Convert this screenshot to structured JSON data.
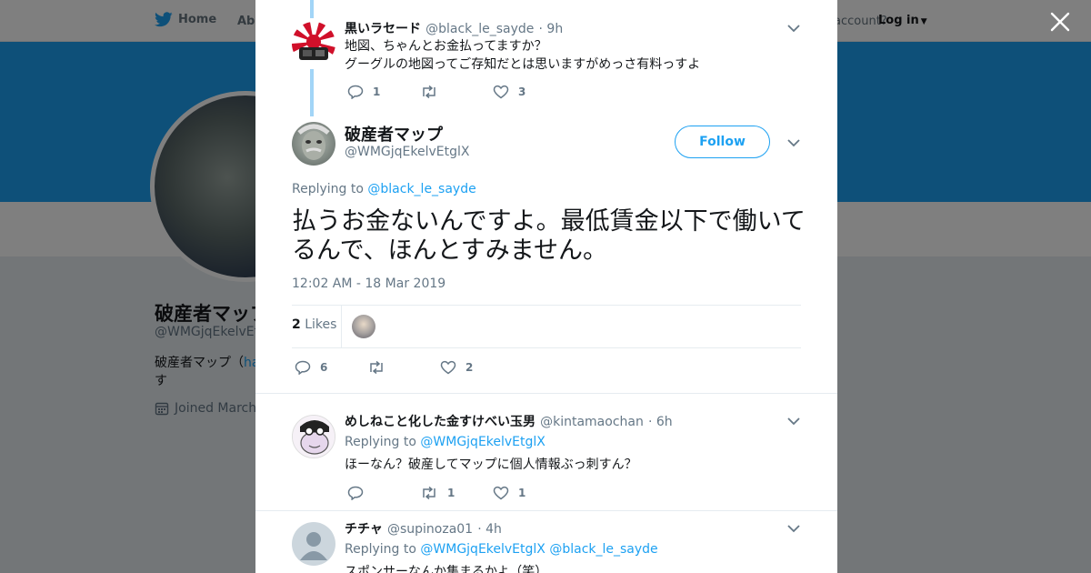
{
  "topbar": {
    "home_label": "Home",
    "about_label": "Abo",
    "account_prompt": "account?",
    "login_label": "Log in"
  },
  "profile": {
    "name": "破産者マップ",
    "handle": "@WMGjqEkelvEtg",
    "bio_prefix": "破産者マップ（",
    "bio_link": "ha",
    "bio_line2": "す",
    "joined": "Joined March"
  },
  "parent_tweet": {
    "name": "黒いラセード",
    "handle": "@black_le_sayde",
    "time": "· 9h",
    "line1": "地図、ちゃんとお金払ってますか？",
    "line2": "グーグルの地図ってご存知だとは思いますがめっさ有料っすよ",
    "replies": "1",
    "retweets": "",
    "likes": "3"
  },
  "main_tweet": {
    "name": "破産者マップ",
    "handle": "@WMGjqEkelvEtglX",
    "follow_label": "Follow",
    "replying_prefix": "Replying to ",
    "replying_to": "@black_le_sayde",
    "text": "払うお金ないんですよ。最低賃金以下で働いてるんで、ほんとすみません。",
    "timestamp": "12:02 AM - 18 Mar 2019",
    "likes_count": "2",
    "likes_label": "Likes",
    "replies": "6",
    "retweets": "",
    "likes": "2"
  },
  "reply1": {
    "name": "めしねこと化した金すけべい玉男",
    "handle": "@kintamaochan",
    "time": "· 6h",
    "replying_prefix": "Replying to ",
    "replying_to": "@WMGjqEkelvEtglX",
    "text": "ほーなん？破産してマップに個人情報ぶっ刺すん？",
    "replies": "",
    "retweets": "1",
    "likes": "1"
  },
  "reply2": {
    "name": "チチャ",
    "handle": "@supinoza01",
    "time": "· 4h",
    "replying_prefix": "Replying to ",
    "replying_to_1": "@WMGjqEkelvEtglX",
    "replying_to_2": "@black_le_sayde",
    "text": "スポンサーなんか集まるかよ（笑）"
  },
  "colors": {
    "accent": "#1da1f2",
    "thread_line": "#a2d5f7",
    "muted": "#657786"
  }
}
